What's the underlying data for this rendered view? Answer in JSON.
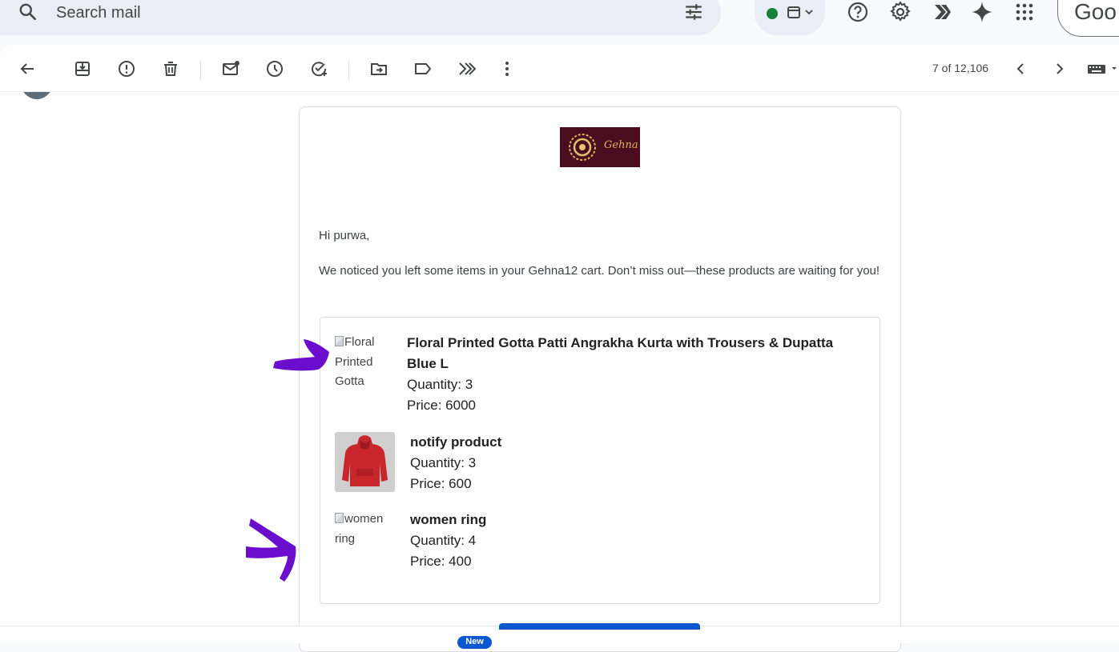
{
  "search": {
    "placeholder": "Search mail"
  },
  "header": {
    "account_text": "Goo"
  },
  "toolbar": {
    "pagination": "7 of 12,106"
  },
  "email": {
    "greeting": "Hi purwa,",
    "message": "We noticed you left some items in your Gehna12 cart. Don’t miss out—these products are waiting for you!",
    "logo_text": "Gehna",
    "items": [
      {
        "image_alt": "Floral Printed Gotta",
        "name": "Floral Printed Gotta Patti Angrakha Kurta with Trousers & Dupatta Blue L",
        "quantity": "Quantity: 3",
        "price": "Price: 6000"
      },
      {
        "image_alt": "",
        "name": "notify product",
        "quantity": "Quantity: 3",
        "price": "Price: 600"
      },
      {
        "image_alt": "women ring",
        "name": "women ring",
        "quantity": "Quantity: 4",
        "price": "Price: 400"
      }
    ],
    "badge": "New"
  },
  "colors": {
    "accent": "#0b57d0",
    "annotation_arrow": "#6a0dcc",
    "logo_bg": "#4a0d20",
    "status_dot": "#188038"
  }
}
